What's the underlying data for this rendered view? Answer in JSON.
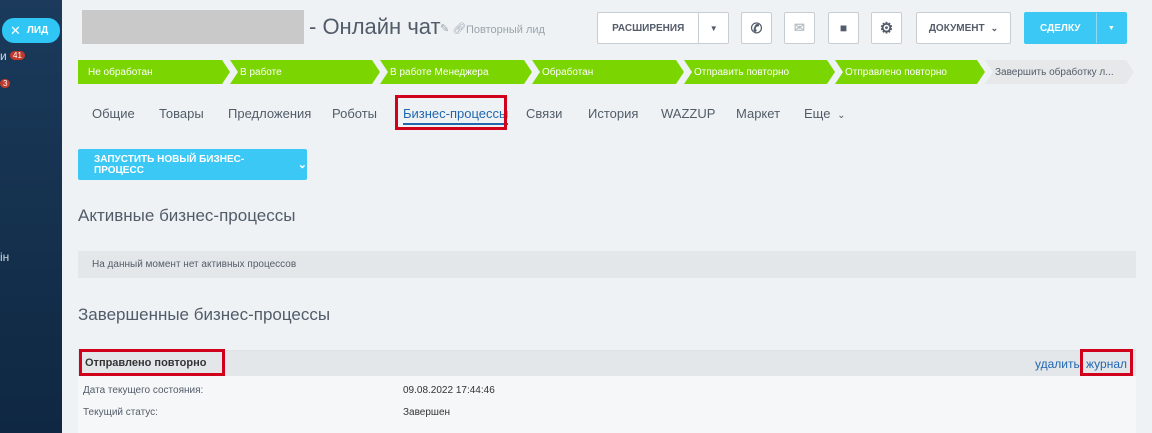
{
  "sidebar": {
    "lid_tab": "ЛИД",
    "badge1": "41",
    "badge2": "3",
    "text1": "и",
    "text2": "ін"
  },
  "header": {
    "title": "- Онлайн чат",
    "subtitle": "Повторный лид",
    "btn_extensions": "РАСШИРЕНИЯ",
    "btn_document": "ДОКУМЕНТ",
    "btn_deal": "СДЕЛКУ"
  },
  "stages": [
    "Не обработан",
    "В работе",
    "В работе Менеджера",
    "Обработан",
    "Отправить повторно",
    "Отправлено повторно",
    "Завершить обработку л..."
  ],
  "tabs": [
    "Общие",
    "Товары",
    "Предложения",
    "Роботы",
    "Бизнес-процессы",
    "Связи",
    "История",
    "WAZZUP",
    "Маркет",
    "Еще"
  ],
  "launch_button": "ЗАПУСТИТЬ НОВЫЙ БИЗНЕС-ПРОЦЕСС",
  "active_section": {
    "title": "Активные бизнес-процессы",
    "empty_text": "На данный момент нет активных процессов"
  },
  "completed_section": {
    "title": "Завершенные бизнес-процессы",
    "process": {
      "name": "Отправлено повторно",
      "delete_link": "удалить",
      "journal_link": "журнал",
      "row1_label": "Дата текущего состояния:",
      "row1_value": "09.08.2022 17:44:46",
      "row2_label": "Текущий статус:",
      "row2_value": "Завершен"
    }
  }
}
